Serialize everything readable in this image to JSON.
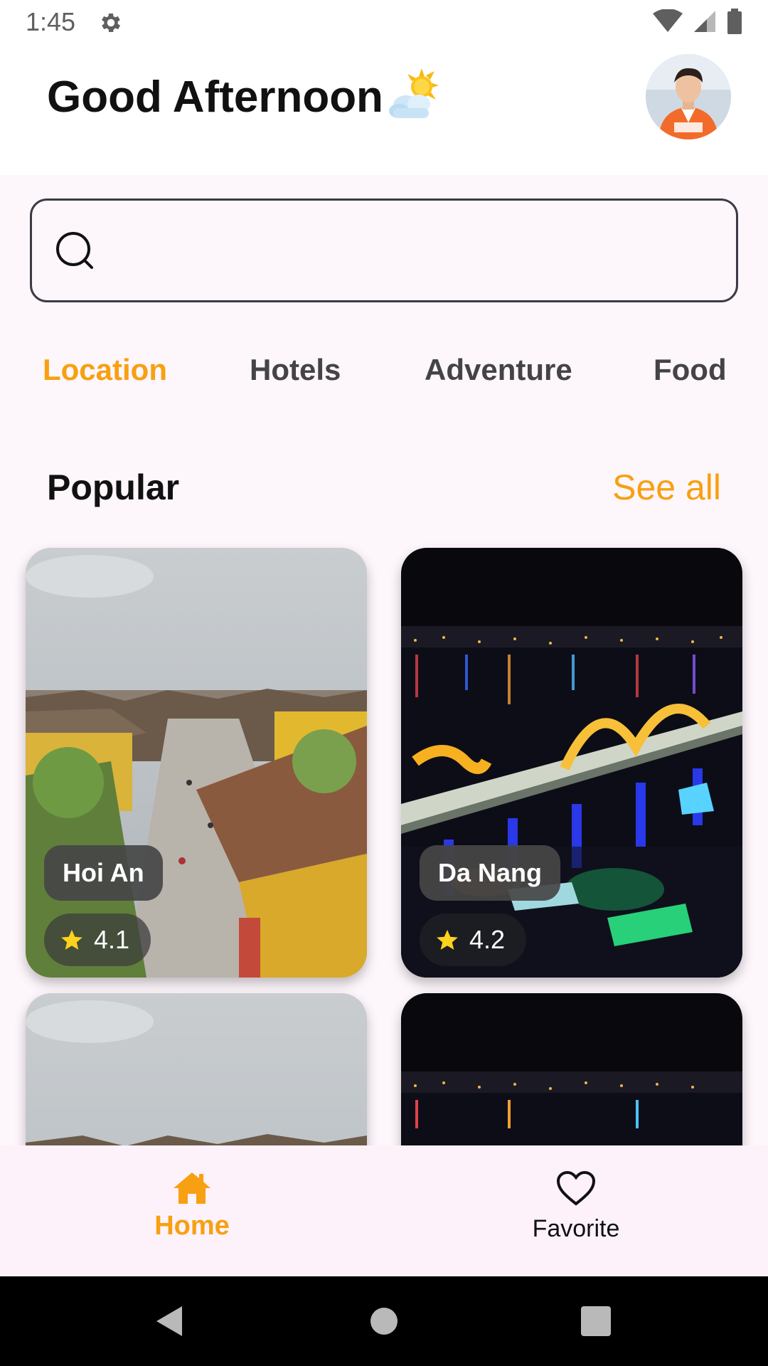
{
  "status_bar": {
    "time": "1:45"
  },
  "header": {
    "greeting": "Good Afternoon",
    "weather_icon": "sun-behind-cloud-icon"
  },
  "search": {
    "placeholder": "",
    "value": ""
  },
  "tabs": [
    {
      "label": "Location",
      "active": true
    },
    {
      "label": "Hotels",
      "active": false
    },
    {
      "label": "Adventure",
      "active": false
    },
    {
      "label": "Food",
      "active": false
    }
  ],
  "section": {
    "title": "Popular",
    "see_all": "See all"
  },
  "cards": [
    {
      "name": "Hoi An",
      "rating": "4.1"
    },
    {
      "name": "Da Nang",
      "rating": "4.2"
    },
    {
      "name": "",
      "rating": ""
    },
    {
      "name": "",
      "rating": ""
    }
  ],
  "bottom_nav": {
    "home_label": "Home",
    "favorite_label": "Favorite"
  },
  "colors": {
    "accent": "#f7a011",
    "background": "#fdf6fb"
  }
}
